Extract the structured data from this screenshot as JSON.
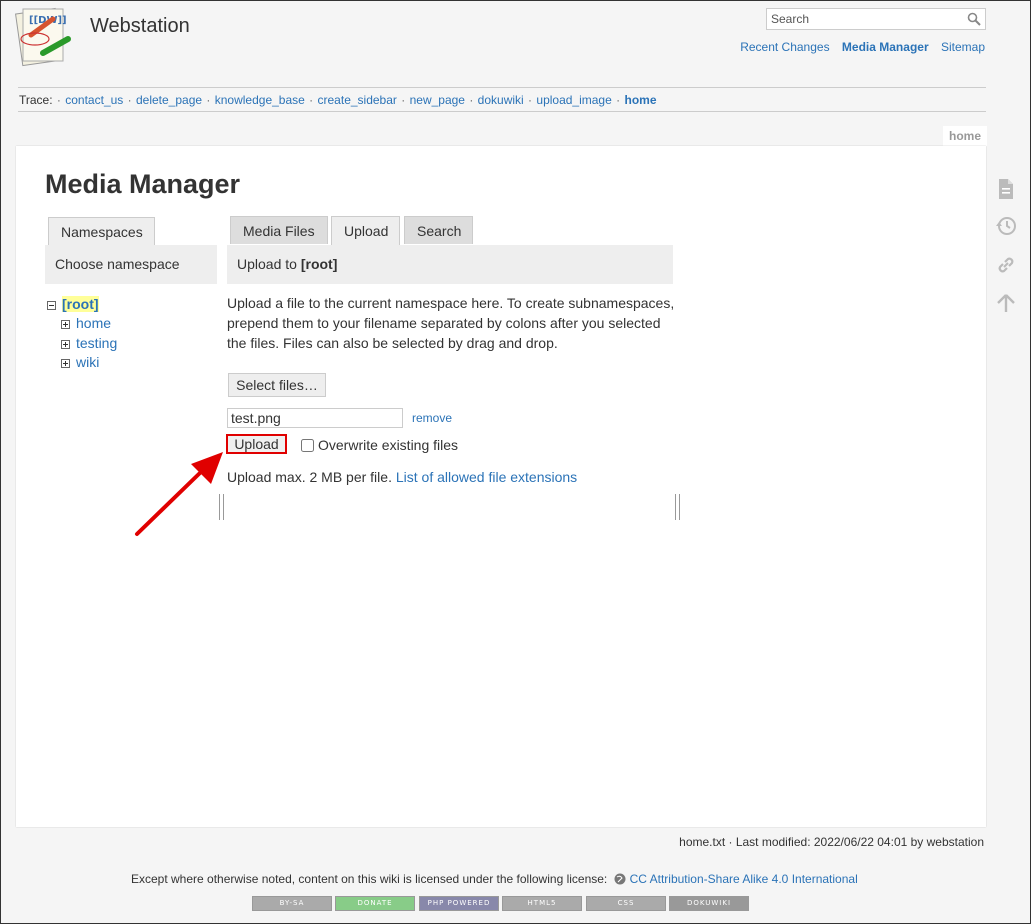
{
  "site": {
    "title": "Webstation",
    "logo_icon": "dokuwiki-logo-icon"
  },
  "search": {
    "placeholder": "Search",
    "icon": "search-icon"
  },
  "user_tools": [
    {
      "label": "Recent Changes",
      "strong": false
    },
    {
      "label": "Media Manager",
      "strong": true
    },
    {
      "label": "Sitemap",
      "strong": false
    }
  ],
  "trace": {
    "label": "Trace:",
    "items": [
      "contact_us",
      "delete_page",
      "knowledge_base",
      "create_sidebar",
      "new_page",
      "dokuwiki",
      "upload_image"
    ],
    "current": "home"
  },
  "page_id": "home",
  "page_title": "Media Manager",
  "namespaces": {
    "tab_label": "Namespaces",
    "header": "Choose namespace",
    "root": "[root]",
    "children": [
      "home",
      "testing",
      "wiki"
    ]
  },
  "media": {
    "tabs": [
      "Media Files",
      "Upload",
      "Search"
    ],
    "active_tab": "Upload",
    "header_prefix": "Upload to ",
    "header_ns": "[root]",
    "description": "Upload a file to the current namespace here. To create subnamespaces, prepend them to your filename separated by colons after you selected the files. Files can also be selected by drag and drop.",
    "select_files_label": "Select files…",
    "file_name": "test.png",
    "remove_label": "remove",
    "upload_label": "Upload",
    "overwrite_label": "Overwrite existing files",
    "overwrite_checked": false,
    "max_text": "Upload max. 2 MB per file. ",
    "extensions_link": "List of allowed file extensions"
  },
  "page_tools": [
    "show-page-icon",
    "old-revisions-icon",
    "backlinks-icon",
    "back-to-top-icon"
  ],
  "footer": {
    "docinfo": "home.txt · Last modified: 2022/06/22 04:01 by webstation",
    "license_prefix": "Except where otherwise noted, content on this wiki is licensed under the following license:",
    "license_link": "CC Attribution-Share Alike 4.0 International",
    "badges": [
      "BY-SA",
      "DONATE",
      "PHP POWERED",
      "HTML5",
      "CSS",
      "DOKUWIKI"
    ]
  },
  "colors": {
    "accent": "#2b73b7",
    "highlight": "#ffff99",
    "annotation": "#e00000"
  }
}
